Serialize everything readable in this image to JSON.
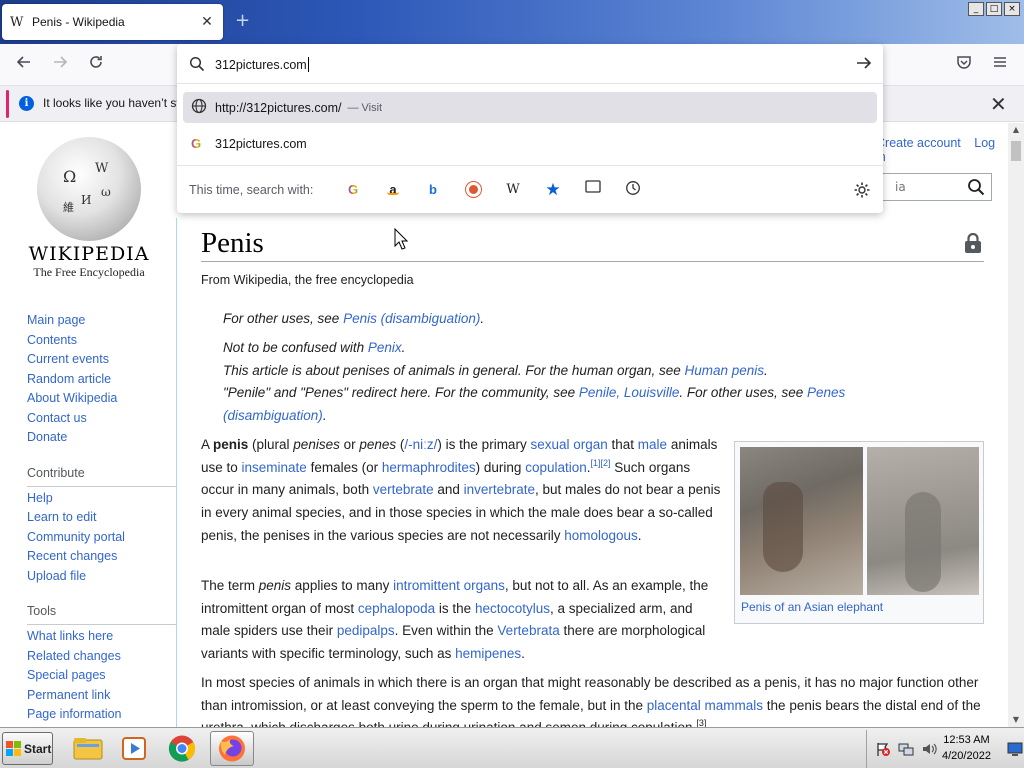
{
  "browser": {
    "tab_title": "Penis - Wikipedia",
    "tab_favicon": "W",
    "new_tab": "+",
    "window_controls": [
      "_",
      "□",
      "×"
    ],
    "url_value": "312pictures.com",
    "notification": "It looks like you haven’t star"
  },
  "url_dropdown": {
    "suggestions": [
      {
        "icon": "globe-icon",
        "text": "http://312pictures.com/",
        "action": "— Visit"
      },
      {
        "icon": "google-icon",
        "text": "312pictures.com",
        "action": ""
      }
    ],
    "search_with_label": "This time, search with:",
    "engines": [
      "google-icon",
      "amazon-icon",
      "bing-icon",
      "duckduckgo-icon",
      "wikipedia-icon",
      "bookmarks-icon",
      "tabs-icon",
      "history-icon"
    ]
  },
  "wiki": {
    "wordmark": "Wikipedia",
    "tagline": "The Free Encyclopedia",
    "top_links": [
      "Create account",
      "Log in"
    ],
    "search_placeholder": "ia",
    "nav_main": [
      "Main page",
      "Contents",
      "Current events",
      "Random article",
      "About Wikipedia",
      "Contact us",
      "Donate"
    ],
    "contribute_head": "Contribute",
    "nav_contribute": [
      "Help",
      "Learn to edit",
      "Community portal",
      "Recent changes",
      "Upload file"
    ],
    "tools_head": "Tools",
    "nav_tools": [
      "What links here",
      "Related changes",
      "Special pages",
      "Permanent link",
      "Page information"
    ],
    "title": "Penis",
    "from": "From Wikipedia, the free encyclopedia",
    "hatnote1_a": "For other uses, see ",
    "hatnote1_link": "Penis (disambiguation)",
    "hatnote1_b": ".",
    "hatnote2_a": "Not to be confused with ",
    "hatnote2_link": "Penix",
    "hatnote2_b": ".",
    "hatnote3_a": "This article is about penises of animals in general. For the human organ, see ",
    "hatnote3_link": "Human penis",
    "hatnote3_b": ".",
    "hatnote4_a": "\"Penile\" and \"Penes\" redirect here. For the community, see ",
    "hatnote4_link1": "Penile, Louisville",
    "hatnote4_b": ". For other uses, see ",
    "hatnote4_link2": "Penes",
    "hatnote4_link3": "(disambiguation)",
    "hatnote4_c": ".",
    "infobox_caption": "Penis of an Asian elephant"
  },
  "taskbar": {
    "start": "Start",
    "time": "12:53 AM",
    "date": "4/20/2022"
  }
}
